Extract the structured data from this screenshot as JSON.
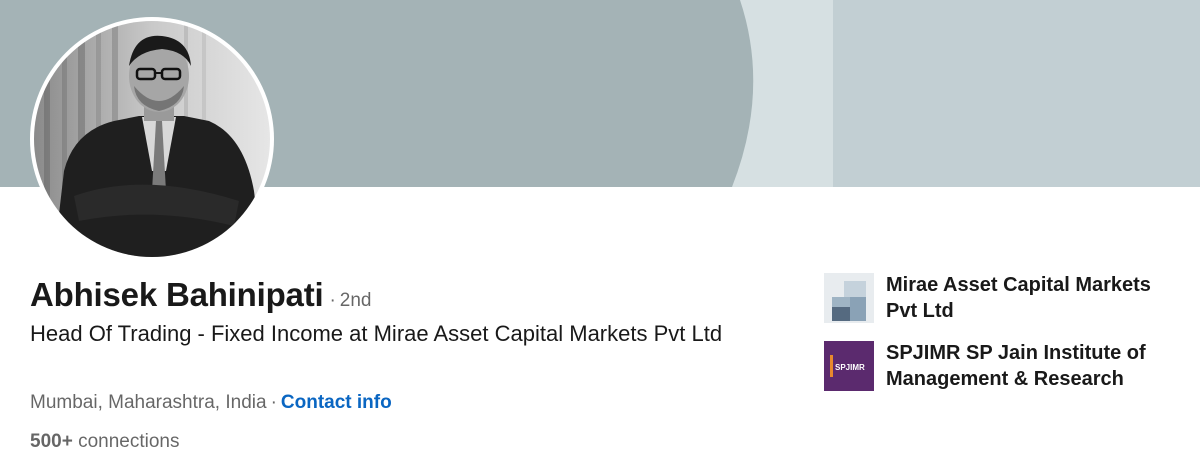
{
  "profile": {
    "name": "Abhisek Bahinipati",
    "degree_separator": "·",
    "degree": "2nd",
    "headline": "Head Of Trading - Fixed Income at Mirae Asset Capital Markets Pvt Ltd",
    "location": "Mumbai, Maharashtra, India",
    "location_separator": "·",
    "contact_info_label": "Contact info",
    "connections_count": "500+",
    "connections_label": "connections"
  },
  "organizations": [
    {
      "name": "Mirae Asset Capital Markets Pvt Ltd",
      "logo_icon": "mirae-asset-logo"
    },
    {
      "name": "SPJIMR SP Jain Institute of Management & Research",
      "logo_icon": "spjimr-logo",
      "logo_text": "SPJIMR"
    }
  ],
  "colors": {
    "banner": "#a4b3b6",
    "banner_light": "#c2cfd3",
    "link": "#0a66c2",
    "spjimr_purple": "#5b2a6e"
  }
}
